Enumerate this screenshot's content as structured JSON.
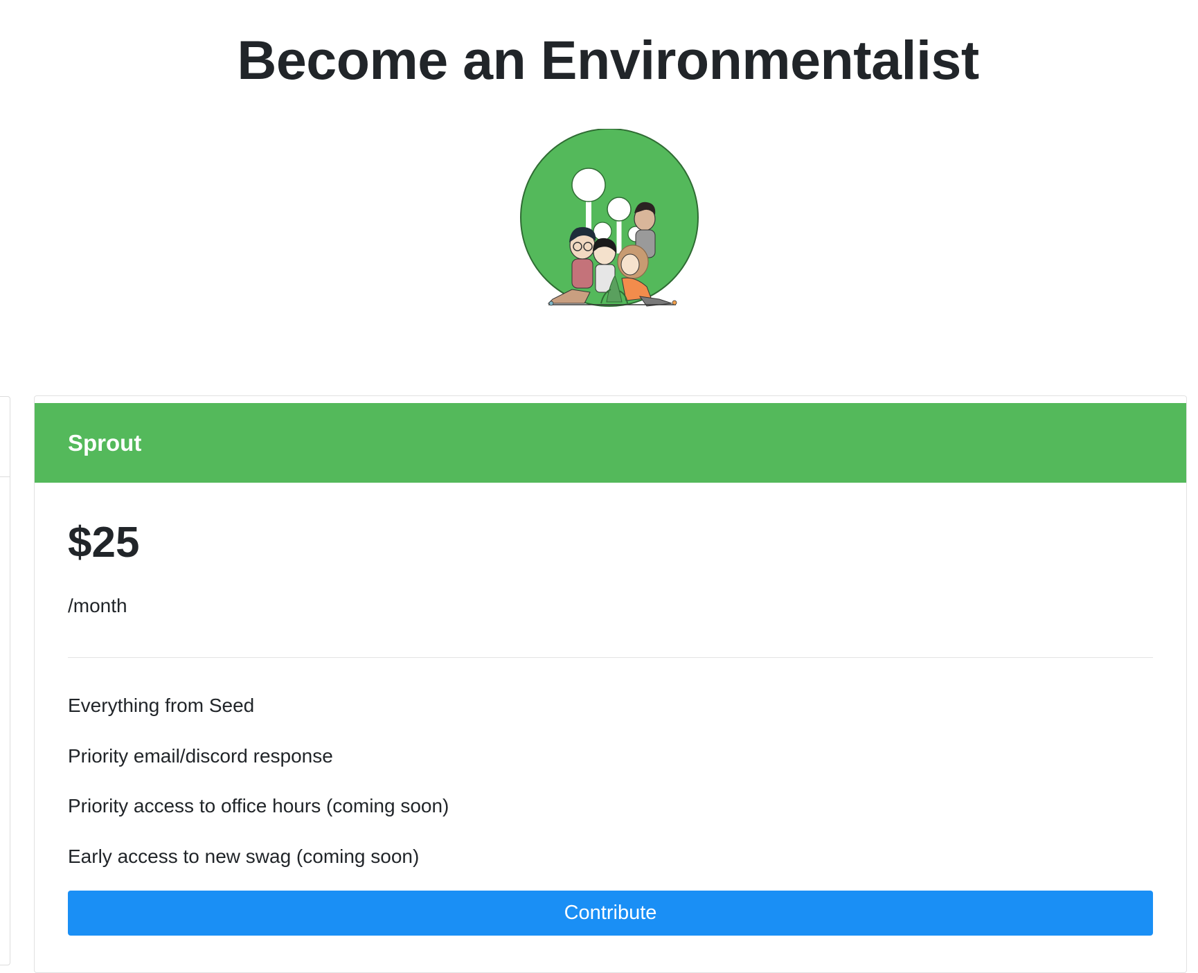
{
  "page": {
    "title": "Become an Environmentalist"
  },
  "logo": {
    "icon": "environmentalist-group-logo",
    "color": "#54b95b"
  },
  "tier": {
    "name": "Sprout",
    "price": "$25",
    "period": "/month",
    "header_color": "#54b95b",
    "features": [
      "Everything from Seed",
      "Priority email/discord response",
      "Priority access to office hours (coming soon)",
      "Early access to new swag (coming soon)"
    ],
    "button_label": "Contribute",
    "button_color": "#1a8ff5"
  }
}
